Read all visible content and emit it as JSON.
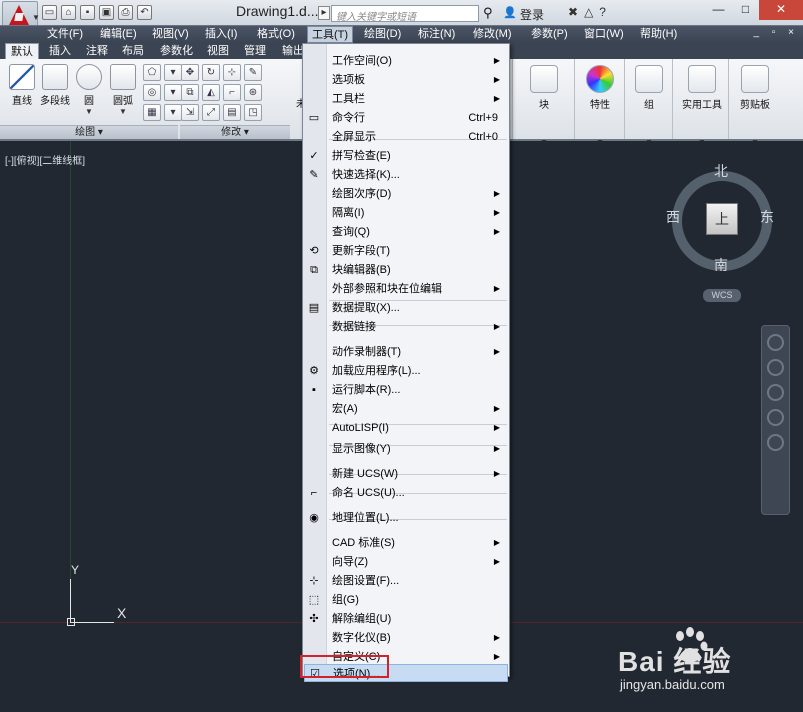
{
  "titlebar": {
    "doc_title": "Drawing1.d...",
    "search_placeholder": "键入关键字或短语",
    "login": "登录",
    "quick_access": [
      "new-icon",
      "open-icon",
      "save-icon",
      "saveas-icon",
      "print-icon",
      "undo-icon"
    ],
    "window_controls": [
      "—",
      "□",
      "✕"
    ]
  },
  "menubar": {
    "items": [
      "文件(F)",
      "编辑(E)",
      "视图(V)",
      "插入(I)",
      "格式(O)",
      "工具(T)",
      "绘图(D)",
      "标注(N)",
      "修改(M)",
      "参数(P)",
      "窗口(W)",
      "帮助(H)"
    ],
    "active_index": 5,
    "mdi_controls": "_ ▫ ×"
  },
  "ribbon_tabs": [
    "默认",
    "插入",
    "注释",
    "布局",
    "参数化",
    "视图",
    "管理",
    "输出"
  ],
  "ribbon": {
    "draw_tools": [
      "直线",
      "多段线",
      "圆",
      "圆弧"
    ],
    "draw_panel_title": "绘图",
    "modify_panel_title": "修改",
    "right_tools": [
      "块",
      "特性",
      "组",
      "实用工具",
      "剪贴板"
    ],
    "partial_labels": [
      "未",
      "文"
    ]
  },
  "canvas": {
    "viewport_label": "[-][俯视][二维线框]",
    "ucs_x": "X",
    "ucs_y": "Y"
  },
  "viewcube": {
    "north": "北",
    "south": "南",
    "east": "东",
    "west": "西",
    "face": "上",
    "wcs": "WCS"
  },
  "dropdown": {
    "items": [
      {
        "label": "工作空间(O)",
        "sub": true
      },
      {
        "label": "选项板",
        "sub": true
      },
      {
        "label": "工具栏",
        "sub": true
      },
      {
        "label": "命令行",
        "shortcut": "Ctrl+9",
        "icon": "command-line-icon"
      },
      {
        "label": "全屏显示",
        "shortcut": "Ctrl+0"
      },
      {
        "label": "拼写检查(E)",
        "icon": "spell-check-icon"
      },
      {
        "label": "快速选择(K)...",
        "icon": "quick-select-icon"
      },
      {
        "label": "绘图次序(D)",
        "sub": true
      },
      {
        "label": "隔离(I)",
        "sub": true
      },
      {
        "label": "查询(Q)",
        "sub": true
      },
      {
        "label": "更新字段(T)",
        "icon": "update-field-icon"
      },
      {
        "label": "块编辑器(B)",
        "icon": "block-editor-icon"
      },
      {
        "label": "外部参照和块在位编辑",
        "sub": true
      },
      {
        "label": "数据提取(X)...",
        "icon": "data-extraction-icon"
      },
      {
        "label": "数据链接",
        "sub": true
      },
      {
        "label": "动作录制器(T)",
        "sub": true
      },
      {
        "label": "加载应用程序(L)...",
        "icon": "load-app-icon"
      },
      {
        "label": "运行脚本(R)...",
        "icon": "run-script-icon"
      },
      {
        "label": "宏(A)",
        "sub": true
      },
      {
        "label": "AutoLISP(I)",
        "sub": true
      },
      {
        "label": "显示图像(Y)",
        "sub": true
      },
      {
        "label": "新建 UCS(W)",
        "sub": true
      },
      {
        "label": "命名 UCS(U)...",
        "icon": "named-ucs-icon"
      },
      {
        "label": "地理位置(L)...",
        "icon": "geolocation-icon"
      },
      {
        "label": "CAD 标准(S)",
        "sub": true
      },
      {
        "label": "向导(Z)",
        "sub": true
      },
      {
        "label": "绘图设置(F)...",
        "icon": "drafting-settings-icon"
      },
      {
        "label": "组(G)",
        "icon": "group-icon"
      },
      {
        "label": "解除编组(U)",
        "icon": "ungroup-icon"
      },
      {
        "label": "数字化仪(B)",
        "sub": true
      },
      {
        "label": "自定义(C)",
        "sub": true
      },
      {
        "label": "选项(N)...",
        "icon": "options-icon",
        "highlighted": true
      }
    ]
  },
  "watermark": {
    "brand": "Bai  经验",
    "url": "jingyan.baidu.com"
  },
  "colors": {
    "accent_red": "#c4161c",
    "menu_bar": "#3b4452",
    "canvas": "#222831",
    "highlight": "#c7dcf3",
    "annotation_box": "#d3222a"
  }
}
